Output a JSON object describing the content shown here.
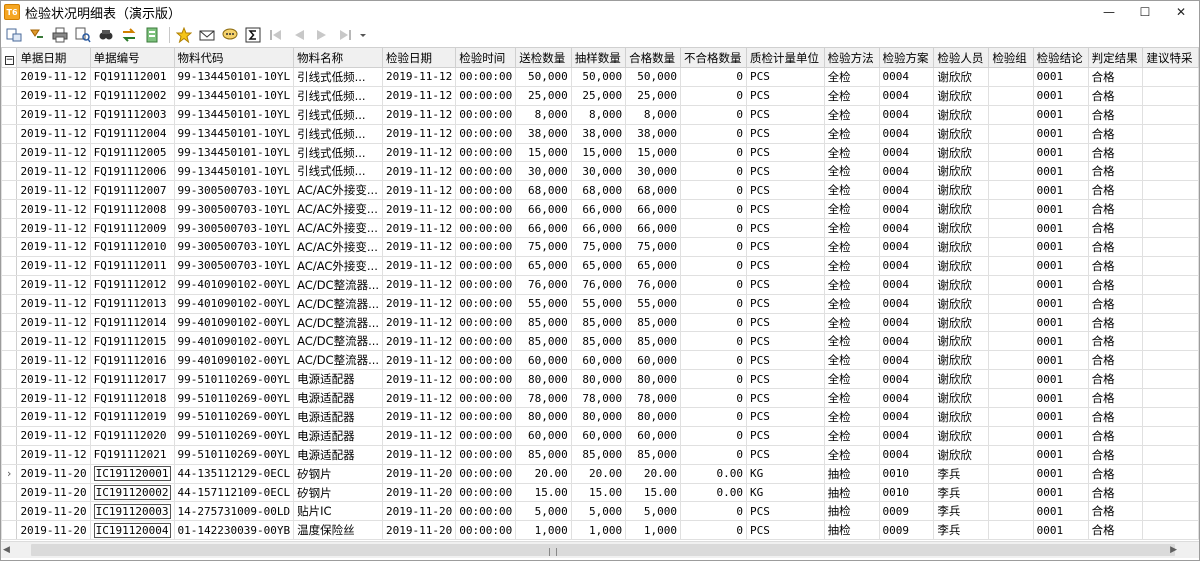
{
  "window": {
    "app_icon_text": "T6",
    "title": "检验状况明细表（演示版）",
    "minimize": "—",
    "maximize": "☐",
    "close": "✕"
  },
  "columns": [
    "单据日期",
    "单据编号",
    "物料代码",
    "物料名称",
    "检验日期",
    "检验时间",
    "送检数量",
    "抽样数量",
    "合格数量",
    "不合格数量",
    "质检计量单位",
    "检验方法",
    "检验方案",
    "检验人员",
    "检验组",
    "检验结论",
    "判定结果",
    "建议特采"
  ],
  "rows": [
    [
      "2019-11-12",
      "FQ191112001",
      "99-134450101-10YL",
      "引线式低频...",
      "2019-11-12",
      "00:00:00",
      "50,000",
      "50,000",
      "50,000",
      "0",
      "PCS",
      "全检",
      "0004",
      "谢欣欣",
      "",
      "0001",
      "合格",
      ""
    ],
    [
      "2019-11-12",
      "FQ191112002",
      "99-134450101-10YL",
      "引线式低频...",
      "2019-11-12",
      "00:00:00",
      "25,000",
      "25,000",
      "25,000",
      "0",
      "PCS",
      "全检",
      "0004",
      "谢欣欣",
      "",
      "0001",
      "合格",
      ""
    ],
    [
      "2019-11-12",
      "FQ191112003",
      "99-134450101-10YL",
      "引线式低频...",
      "2019-11-12",
      "00:00:00",
      "8,000",
      "8,000",
      "8,000",
      "0",
      "PCS",
      "全检",
      "0004",
      "谢欣欣",
      "",
      "0001",
      "合格",
      ""
    ],
    [
      "2019-11-12",
      "FQ191112004",
      "99-134450101-10YL",
      "引线式低频...",
      "2019-11-12",
      "00:00:00",
      "38,000",
      "38,000",
      "38,000",
      "0",
      "PCS",
      "全检",
      "0004",
      "谢欣欣",
      "",
      "0001",
      "合格",
      ""
    ],
    [
      "2019-11-12",
      "FQ191112005",
      "99-134450101-10YL",
      "引线式低频...",
      "2019-11-12",
      "00:00:00",
      "15,000",
      "15,000",
      "15,000",
      "0",
      "PCS",
      "全检",
      "0004",
      "谢欣欣",
      "",
      "0001",
      "合格",
      ""
    ],
    [
      "2019-11-12",
      "FQ191112006",
      "99-134450101-10YL",
      "引线式低频...",
      "2019-11-12",
      "00:00:00",
      "30,000",
      "30,000",
      "30,000",
      "0",
      "PCS",
      "全检",
      "0004",
      "谢欣欣",
      "",
      "0001",
      "合格",
      ""
    ],
    [
      "2019-11-12",
      "FQ191112007",
      "99-300500703-10YL",
      "AC/AC外接变...",
      "2019-11-12",
      "00:00:00",
      "68,000",
      "68,000",
      "68,000",
      "0",
      "PCS",
      "全检",
      "0004",
      "谢欣欣",
      "",
      "0001",
      "合格",
      ""
    ],
    [
      "2019-11-12",
      "FQ191112008",
      "99-300500703-10YL",
      "AC/AC外接变...",
      "2019-11-12",
      "00:00:00",
      "66,000",
      "66,000",
      "66,000",
      "0",
      "PCS",
      "全检",
      "0004",
      "谢欣欣",
      "",
      "0001",
      "合格",
      ""
    ],
    [
      "2019-11-12",
      "FQ191112009",
      "99-300500703-10YL",
      "AC/AC外接变...",
      "2019-11-12",
      "00:00:00",
      "66,000",
      "66,000",
      "66,000",
      "0",
      "PCS",
      "全检",
      "0004",
      "谢欣欣",
      "",
      "0001",
      "合格",
      ""
    ],
    [
      "2019-11-12",
      "FQ191112010",
      "99-300500703-10YL",
      "AC/AC外接变...",
      "2019-11-12",
      "00:00:00",
      "75,000",
      "75,000",
      "75,000",
      "0",
      "PCS",
      "全检",
      "0004",
      "谢欣欣",
      "",
      "0001",
      "合格",
      ""
    ],
    [
      "2019-11-12",
      "FQ191112011",
      "99-300500703-10YL",
      "AC/AC外接变...",
      "2019-11-12",
      "00:00:00",
      "65,000",
      "65,000",
      "65,000",
      "0",
      "PCS",
      "全检",
      "0004",
      "谢欣欣",
      "",
      "0001",
      "合格",
      ""
    ],
    [
      "2019-11-12",
      "FQ191112012",
      "99-401090102-00YL",
      "AC/DC整流器...",
      "2019-11-12",
      "00:00:00",
      "76,000",
      "76,000",
      "76,000",
      "0",
      "PCS",
      "全检",
      "0004",
      "谢欣欣",
      "",
      "0001",
      "合格",
      ""
    ],
    [
      "2019-11-12",
      "FQ191112013",
      "99-401090102-00YL",
      "AC/DC整流器...",
      "2019-11-12",
      "00:00:00",
      "55,000",
      "55,000",
      "55,000",
      "0",
      "PCS",
      "全检",
      "0004",
      "谢欣欣",
      "",
      "0001",
      "合格",
      ""
    ],
    [
      "2019-11-12",
      "FQ191112014",
      "99-401090102-00YL",
      "AC/DC整流器...",
      "2019-11-12",
      "00:00:00",
      "85,000",
      "85,000",
      "85,000",
      "0",
      "PCS",
      "全检",
      "0004",
      "谢欣欣",
      "",
      "0001",
      "合格",
      ""
    ],
    [
      "2019-11-12",
      "FQ191112015",
      "99-401090102-00YL",
      "AC/DC整流器...",
      "2019-11-12",
      "00:00:00",
      "85,000",
      "85,000",
      "85,000",
      "0",
      "PCS",
      "全检",
      "0004",
      "谢欣欣",
      "",
      "0001",
      "合格",
      ""
    ],
    [
      "2019-11-12",
      "FQ191112016",
      "99-401090102-00YL",
      "AC/DC整流器...",
      "2019-11-12",
      "00:00:00",
      "60,000",
      "60,000",
      "60,000",
      "0",
      "PCS",
      "全检",
      "0004",
      "谢欣欣",
      "",
      "0001",
      "合格",
      ""
    ],
    [
      "2019-11-12",
      "FQ191112017",
      "99-510110269-00YL",
      "电源适配器",
      "2019-11-12",
      "00:00:00",
      "80,000",
      "80,000",
      "80,000",
      "0",
      "PCS",
      "全检",
      "0004",
      "谢欣欣",
      "",
      "0001",
      "合格",
      ""
    ],
    [
      "2019-11-12",
      "FQ191112018",
      "99-510110269-00YL",
      "电源适配器",
      "2019-11-12",
      "00:00:00",
      "78,000",
      "78,000",
      "78,000",
      "0",
      "PCS",
      "全检",
      "0004",
      "谢欣欣",
      "",
      "0001",
      "合格",
      ""
    ],
    [
      "2019-11-12",
      "FQ191112019",
      "99-510110269-00YL",
      "电源适配器",
      "2019-11-12",
      "00:00:00",
      "80,000",
      "80,000",
      "80,000",
      "0",
      "PCS",
      "全检",
      "0004",
      "谢欣欣",
      "",
      "0001",
      "合格",
      ""
    ],
    [
      "2019-11-12",
      "FQ191112020",
      "99-510110269-00YL",
      "电源适配器",
      "2019-11-12",
      "00:00:00",
      "60,000",
      "60,000",
      "60,000",
      "0",
      "PCS",
      "全检",
      "0004",
      "谢欣欣",
      "",
      "0001",
      "合格",
      ""
    ],
    [
      "2019-11-12",
      "FQ191112021",
      "99-510110269-00YL",
      "电源适配器",
      "2019-11-12",
      "00:00:00",
      "85,000",
      "85,000",
      "85,000",
      "0",
      "PCS",
      "全检",
      "0004",
      "谢欣欣",
      "",
      "0001",
      "合格",
      ""
    ],
    [
      "2019-11-20",
      "IC191120001",
      "44-135112129-0ECL",
      "矽钢片",
      "2019-11-20",
      "00:00:00",
      "20.00",
      "20.00",
      "20.00",
      "0.00",
      "KG",
      "抽检",
      "0010",
      "李兵",
      "",
      "0001",
      "合格",
      ""
    ],
    [
      "2019-11-20",
      "IC191120002",
      "44-157112109-0ECL",
      "矽钢片",
      "2019-11-20",
      "00:00:00",
      "15.00",
      "15.00",
      "15.00",
      "0.00",
      "KG",
      "抽检",
      "0010",
      "李兵",
      "",
      "0001",
      "合格",
      ""
    ],
    [
      "2019-11-20",
      "IC191120003",
      "14-275731009-00LD",
      "贴片IC",
      "2019-11-20",
      "00:00:00",
      "5,000",
      "5,000",
      "5,000",
      "0",
      "PCS",
      "抽检",
      "0009",
      "李兵",
      "",
      "0001",
      "合格",
      ""
    ],
    [
      "2019-11-20",
      "IC191120004",
      "01-142230039-00YB",
      "温度保险丝",
      "2019-11-20",
      "00:00:00",
      "1,000",
      "1,000",
      "1,000",
      "0",
      "PCS",
      "抽检",
      "0009",
      "李兵",
      "",
      "0001",
      "合格",
      ""
    ]
  ],
  "current_row_marker": "›",
  "current_row_index": 21,
  "collapse_symbol": "−"
}
